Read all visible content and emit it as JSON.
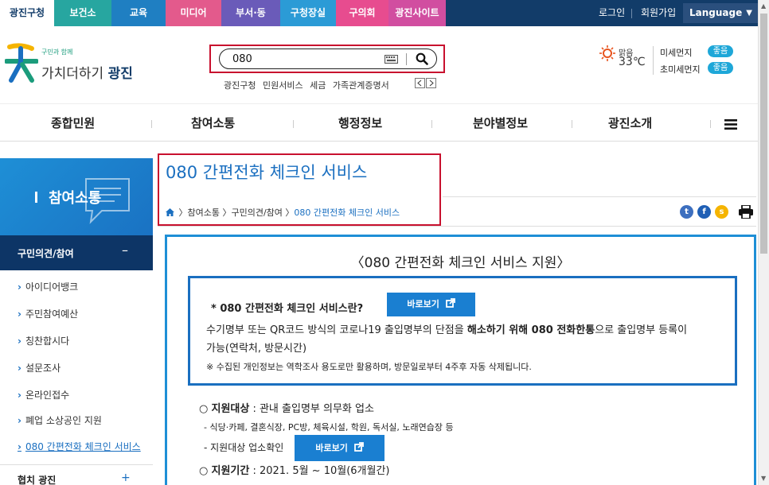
{
  "topbar": {
    "tabs": [
      "광진구청",
      "보건소",
      "교육",
      "미디어",
      "부서·동",
      "구청장실",
      "구의회",
      "광진사이트"
    ],
    "login": "로그인",
    "join": "회원가입",
    "language": "Language",
    "colors": {
      "bar": "#123c69"
    }
  },
  "header": {
    "logo_small": "구민과 함께",
    "logo_text_a": "가치더하기 ",
    "logo_text_b": "광진",
    "search_value": "080",
    "quick_links": [
      "광진구청",
      "민원서비스",
      "세금",
      "가족관계증명서"
    ],
    "weather_status": "맑음",
    "weather_temp": "33℃",
    "dust_label": "미세먼지",
    "dust_value": "좋음",
    "fine_dust_label": "초미세먼지",
    "fine_dust_value": "좋음"
  },
  "nav": {
    "items": [
      "종합민원",
      "참여소통",
      "행정정보",
      "분야별정보",
      "광진소개"
    ]
  },
  "sidebar": {
    "title": "참여소통",
    "section": "구민의견/참여",
    "section_toggle": "–",
    "items": [
      "아이디어뱅크",
      "주민참여예산",
      "칭찬합시다",
      "설문조사",
      "온라인접수",
      "폐업 소상공인 지원",
      "080 간편전화 체크인 서비스"
    ],
    "bottom": "협치 광진",
    "bottom_toggle": "+"
  },
  "page": {
    "title": "080 간편전화 체크인 서비스",
    "breadcrumb": [
      "참여소통",
      "구민의견/참여",
      "080 간편전화 체크인 서비스"
    ]
  },
  "content": {
    "heading": "〈080 간편전화 체크인 서비스 지원〉",
    "info_title": "* 080 간편전화 체크인 서비스란?",
    "view_button": "바로보기",
    "info_line1_a": "수기명부 또는 QR코드 방식의 코로나19 출입명부의 단점을 ",
    "info_line1_b": "해소하기 위해 080 전화한통",
    "info_line1_c": "으로 출입명부 등록이",
    "info_line2": "가능(연락처, 방문시간)",
    "info_note": "※ 수집된 개인정보는 역학조사 용도로만 활용하며, 방문일로부터 4주후 자동 삭제됩니다.",
    "target_label": "지원대상",
    "target_text": " : 관내 출입명부 의무화 업소",
    "target_sub": "- 식당·카페, 결혼식장, PC방, 체육시설, 학원, 독서실, 노래연습장 등",
    "check_label": "- 지원대상 업소확인",
    "period_label": "지원기간",
    "period_text": " : 2021. 5월 ~ 10월(6개월간)"
  }
}
